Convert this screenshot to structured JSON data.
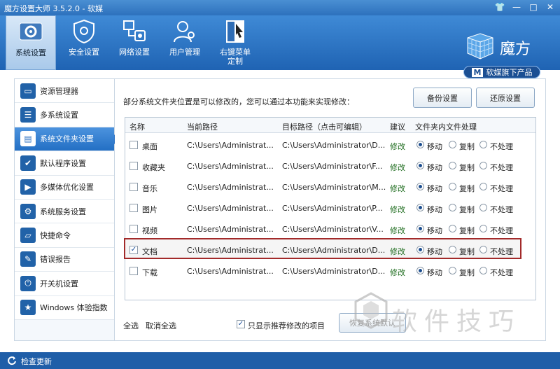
{
  "window": {
    "title": "魔方设置大师 3.5.2.0 - 软媒",
    "controls": [
      "👕",
      "—",
      "□",
      "✕"
    ]
  },
  "toolbar": {
    "items": [
      {
        "label": "系统设置",
        "icon": "gear-icon"
      },
      {
        "label": "安全设置",
        "icon": "shield-icon"
      },
      {
        "label": "网络设置",
        "icon": "network-icon"
      },
      {
        "label": "用户管理",
        "icon": "users-icon"
      },
      {
        "label": "右键菜单",
        "label2": "定制",
        "icon": "cursor-icon"
      }
    ]
  },
  "brand": {
    "name": "魔方",
    "sub": "软媒旗下产品",
    "sub_icon": "M"
  },
  "sidebar": {
    "items": [
      {
        "label": "资源管理器",
        "glyph": "▭"
      },
      {
        "label": "多系统设置",
        "glyph": "☰"
      },
      {
        "label": "系统文件夹设置",
        "glyph": "▤"
      },
      {
        "label": "默认程序设置",
        "glyph": "✔"
      },
      {
        "label": "多媒体优化设置",
        "glyph": "▶"
      },
      {
        "label": "系统服务设置",
        "glyph": "⚙"
      },
      {
        "label": "快捷命令",
        "glyph": "▱"
      },
      {
        "label": "错误报告",
        "glyph": "✎"
      },
      {
        "label": "开关机设置",
        "glyph": "⏻"
      },
      {
        "label": "Windows 体验指数",
        "glyph": "★"
      }
    ]
  },
  "main": {
    "description": "部分系统文件夹位置是可以修改的，您可以通过本功能来实现修改：",
    "backup_label": "备份设置",
    "restore_label": "还原设置",
    "table": {
      "headers": {
        "name": "名称",
        "current": "当前路径",
        "target": "目标路径（点击可编辑）",
        "suggest": "建议",
        "handling": "文件夹内文件处理"
      },
      "rows": [
        {
          "name": "桌面",
          "current": "C:\\Users\\Administrat...",
          "target": "C:\\Users\\Administrator\\D...",
          "suggest": "修改",
          "checked": false
        },
        {
          "name": "收藏夹",
          "current": "C:\\Users\\Administrat...",
          "target": "C:\\Users\\Administrator\\F...",
          "suggest": "修改",
          "checked": false
        },
        {
          "name": "音乐",
          "current": "C:\\Users\\Administrat...",
          "target": "C:\\Users\\Administrator\\M...",
          "suggest": "修改",
          "checked": false
        },
        {
          "name": "图片",
          "current": "C:\\Users\\Administrat...",
          "target": "C:\\Users\\Administrator\\P...",
          "suggest": "修改",
          "checked": false
        },
        {
          "name": "视频",
          "current": "C:\\Users\\Administrat...",
          "target": "C:\\Users\\Administrator\\V...",
          "suggest": "修改",
          "checked": false
        },
        {
          "name": "文档",
          "current": "C:\\Users\\Administrat...",
          "target": "C:\\Users\\Administrator\\D...",
          "suggest": "修改",
          "checked": true
        },
        {
          "name": "下载",
          "current": "C:\\Users\\Administrat...",
          "target": "C:\\Users\\Administrator\\D...",
          "suggest": "修改",
          "checked": false
        }
      ],
      "options": {
        "move": "移动",
        "copy": "复制",
        "none": "不处理"
      }
    },
    "footer": {
      "select_all": "全选",
      "deselect_all": "取消全选",
      "only_recommended": "只显示推荐修改的项目",
      "only_recommended_checked": true,
      "restore_default": "恢复系统默认"
    }
  },
  "status": {
    "check_update": "检查更新"
  },
  "watermark": {
    "text": "软件技巧"
  },
  "colors": {
    "accent": "#2f73c3",
    "highlight_border": "#a22a2a",
    "status_bar": "#1f5ea8",
    "suggest": "#1a6a1a"
  }
}
